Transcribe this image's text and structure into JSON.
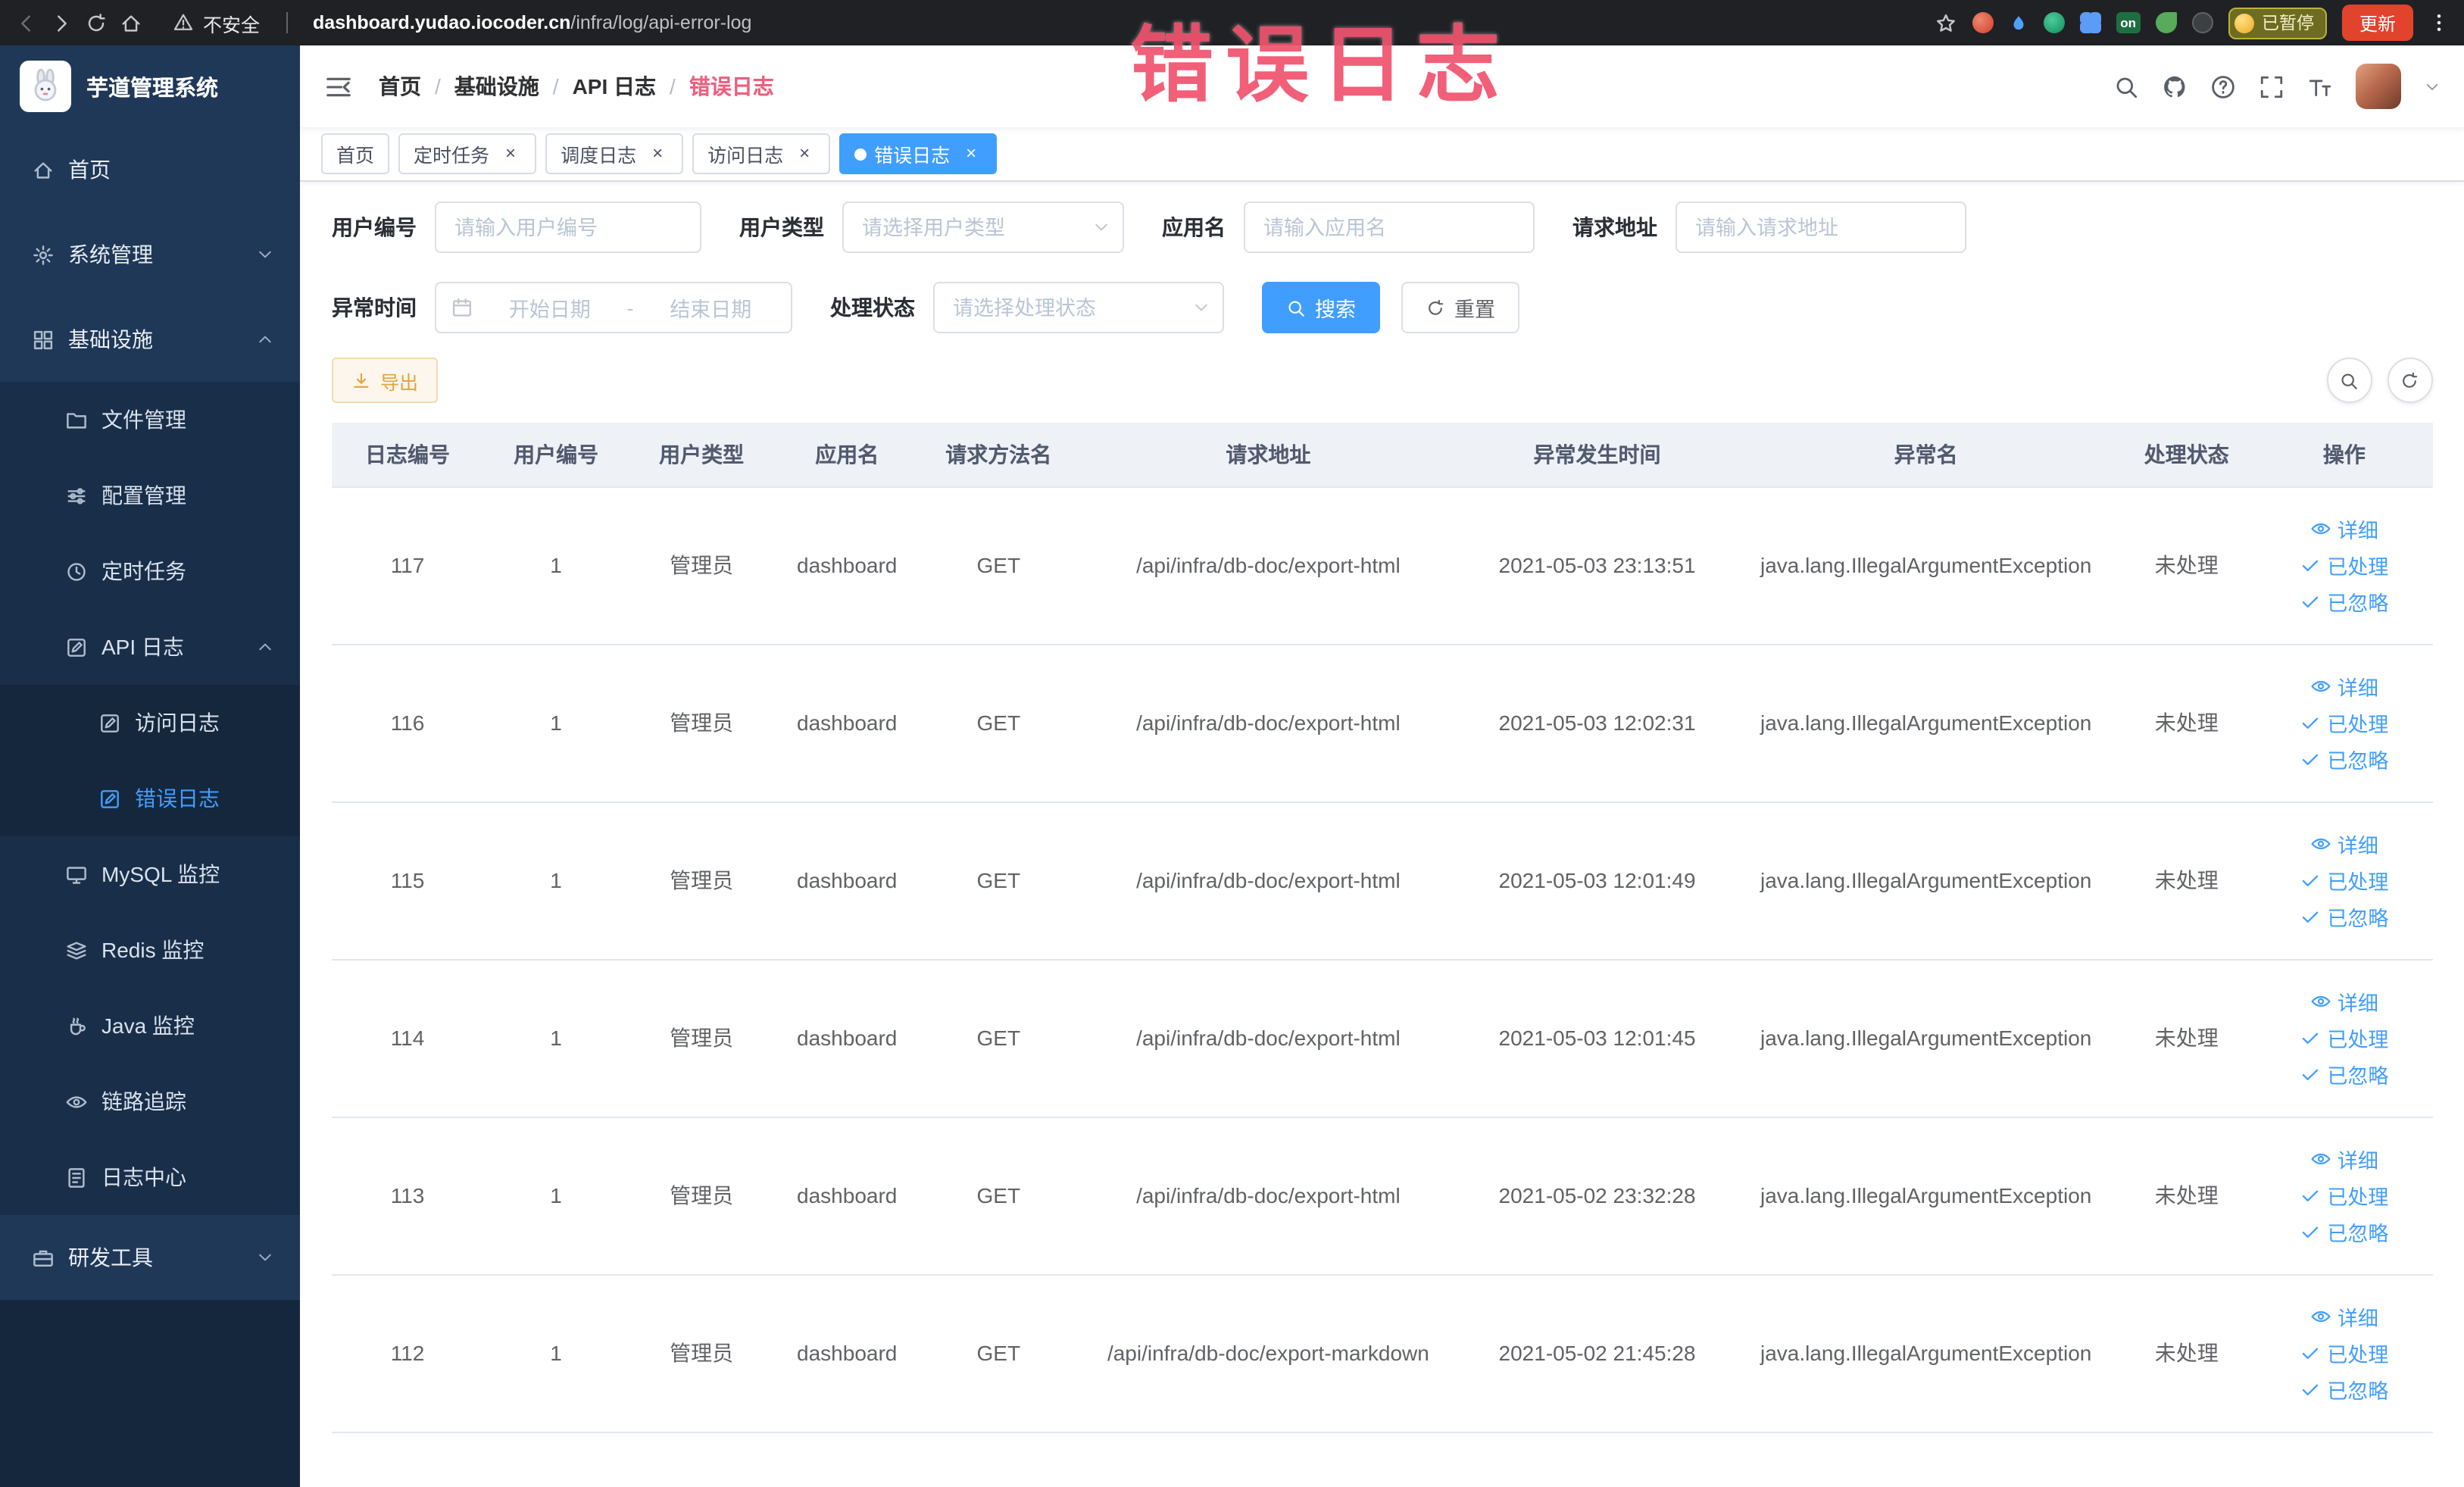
{
  "browser": {
    "security_label": "不安全",
    "url_domain": "dashboard.yudao.iocoder.cn",
    "url_path": "/infra/log/api-error-log",
    "ext_on_label": "on",
    "paused_badge": "已暂停",
    "update_button": "更新"
  },
  "watermark": "错误日志",
  "sidebar": {
    "title": "芋道管理系统",
    "items": [
      {
        "label": "首页",
        "icon": "home",
        "type": "top"
      },
      {
        "label": "系统管理",
        "icon": "gear",
        "type": "top",
        "chevron": "down"
      },
      {
        "label": "基础设施",
        "icon": "grid",
        "type": "top",
        "chevron": "up"
      },
      {
        "label": "文件管理",
        "icon": "folder",
        "type": "sub"
      },
      {
        "label": "配置管理",
        "icon": "sliders",
        "type": "sub"
      },
      {
        "label": "定时任务",
        "icon": "clock",
        "type": "sub"
      },
      {
        "label": "API 日志",
        "icon": "edit",
        "type": "sub",
        "chevron": "up"
      },
      {
        "label": "访问日志",
        "icon": "edit",
        "type": "subsub"
      },
      {
        "label": "错误日志",
        "icon": "edit",
        "type": "subsub",
        "active": true
      },
      {
        "label": "MySQL 监控",
        "icon": "monitor",
        "type": "sub"
      },
      {
        "label": "Redis 监控",
        "icon": "layers",
        "type": "sub"
      },
      {
        "label": "Java 监控",
        "icon": "coffee",
        "type": "sub"
      },
      {
        "label": "链路追踪",
        "icon": "eye",
        "type": "sub"
      },
      {
        "label": "日志中心",
        "icon": "doc",
        "type": "sub"
      },
      {
        "label": "研发工具",
        "icon": "briefcase",
        "type": "top",
        "chevron": "down"
      }
    ]
  },
  "breadcrumb": {
    "separator": "/",
    "items": [
      "首页",
      "基础设施",
      "API 日志",
      "错误日志"
    ]
  },
  "tabs": [
    {
      "label": "首页",
      "active": false,
      "closable": false
    },
    {
      "label": "定时任务",
      "active": false,
      "closable": true
    },
    {
      "label": "调度日志",
      "active": false,
      "closable": true
    },
    {
      "label": "访问日志",
      "active": false,
      "closable": true
    },
    {
      "label": "错误日志",
      "active": true,
      "closable": true
    }
  ],
  "filters": {
    "user_id": {
      "label": "用户编号",
      "placeholder": "请输入用户编号"
    },
    "user_type": {
      "label": "用户类型",
      "placeholder": "请选择用户类型"
    },
    "app_name": {
      "label": "应用名",
      "placeholder": "请输入应用名"
    },
    "request_url": {
      "label": "请求地址",
      "placeholder": "请输入请求地址"
    },
    "exception_time": {
      "label": "异常时间",
      "start_placeholder": "开始日期",
      "separator": "-",
      "end_placeholder": "结束日期"
    },
    "process_status": {
      "label": "处理状态",
      "placeholder": "请选择处理状态"
    },
    "search_button": "搜索",
    "reset_button": "重置"
  },
  "toolbar": {
    "export_button": "导出"
  },
  "table": {
    "columns": [
      {
        "key": "id",
        "label": "日志编号"
      },
      {
        "key": "user_id",
        "label": "用户编号"
      },
      {
        "key": "user_type",
        "label": "用户类型"
      },
      {
        "key": "app",
        "label": "应用名"
      },
      {
        "key": "method",
        "label": "请求方法名"
      },
      {
        "key": "url",
        "label": "请求地址"
      },
      {
        "key": "time",
        "label": "异常发生时间"
      },
      {
        "key": "exception",
        "label": "异常名"
      },
      {
        "key": "status",
        "label": "处理状态"
      },
      {
        "key": "actions",
        "label": "操作"
      }
    ],
    "actions": {
      "detail": "详细",
      "processed": "已处理",
      "ignored": "已忽略"
    },
    "rows": [
      {
        "id": "117",
        "user_id": "1",
        "user_type": "管理员",
        "app": "dashboard",
        "method": "GET",
        "url": "/api/infra/db-doc/export-html",
        "time": "2021-05-03 23:13:51",
        "exception": "java.lang.IllegalArgumentException",
        "status": "未处理"
      },
      {
        "id": "116",
        "user_id": "1",
        "user_type": "管理员",
        "app": "dashboard",
        "method": "GET",
        "url": "/api/infra/db-doc/export-html",
        "time": "2021-05-03 12:02:31",
        "exception": "java.lang.IllegalArgumentException",
        "status": "未处理"
      },
      {
        "id": "115",
        "user_id": "1",
        "user_type": "管理员",
        "app": "dashboard",
        "method": "GET",
        "url": "/api/infra/db-doc/export-html",
        "time": "2021-05-03 12:01:49",
        "exception": "java.lang.IllegalArgumentException",
        "status": "未处理"
      },
      {
        "id": "114",
        "user_id": "1",
        "user_type": "管理员",
        "app": "dashboard",
        "method": "GET",
        "url": "/api/infra/db-doc/export-html",
        "time": "2021-05-03 12:01:45",
        "exception": "java.lang.IllegalArgumentException",
        "status": "未处理"
      },
      {
        "id": "113",
        "user_id": "1",
        "user_type": "管理员",
        "app": "dashboard",
        "method": "GET",
        "url": "/api/infra/db-doc/export-html",
        "time": "2021-05-02 23:32:28",
        "exception": "java.lang.IllegalArgumentException",
        "status": "未处理"
      },
      {
        "id": "112",
        "user_id": "1",
        "user_type": "管理员",
        "app": "dashboard",
        "method": "GET",
        "url": "/api/infra/db-doc/export-markdown",
        "time": "2021-05-02 21:45:28",
        "exception": "java.lang.IllegalArgumentException",
        "status": "未处理"
      }
    ]
  }
}
